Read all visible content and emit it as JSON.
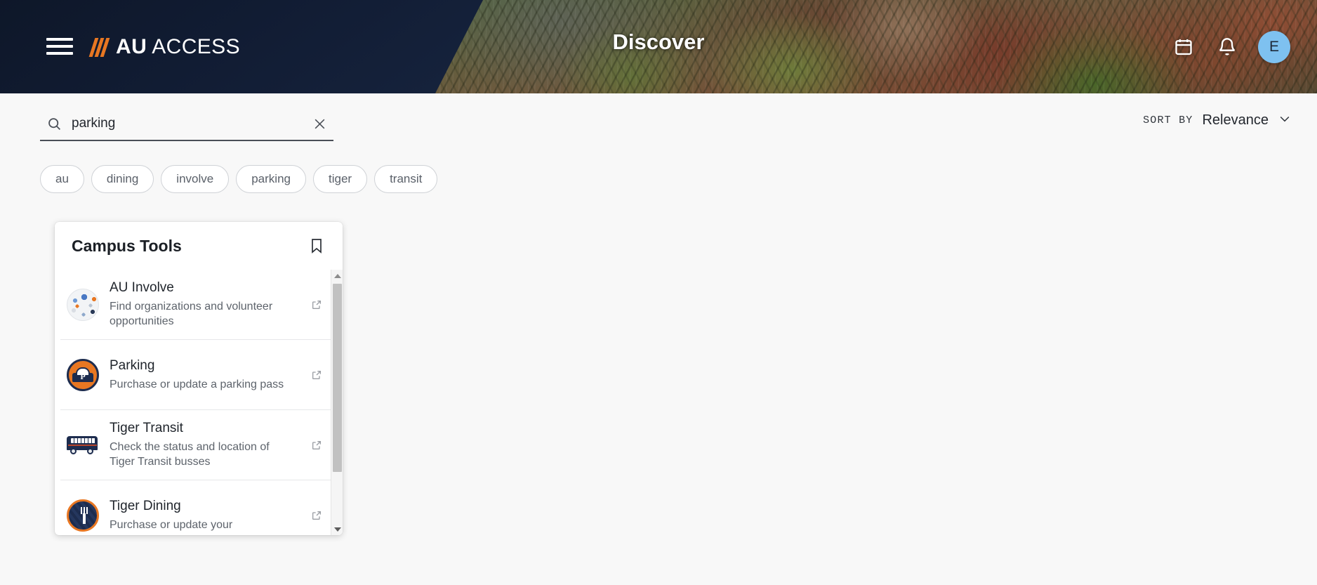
{
  "header": {
    "menu_icon": "hamburger-icon",
    "brand": {
      "bold": "AU",
      "light": "ACCESS",
      "accent_color": "#e87722"
    },
    "page_title": "Discover",
    "navy_color": "#111c33",
    "actions": [
      {
        "name": "calendar-icon",
        "label": "Calendar"
      },
      {
        "name": "bell-icon",
        "label": "Notifications"
      }
    ],
    "avatar": {
      "initial": "E",
      "color": "#7ec1f0"
    }
  },
  "search": {
    "icon": "search-icon",
    "value": "parking",
    "placeholder": "Search",
    "clear_icon": "close-icon"
  },
  "sort": {
    "label": "SORT BY",
    "value": "Relevance",
    "chevron_icon": "chevron-down-icon",
    "options": [
      "Relevance"
    ]
  },
  "chips": [
    {
      "label": "au"
    },
    {
      "label": "dining"
    },
    {
      "label": "involve"
    },
    {
      "label": "parking"
    },
    {
      "label": "tiger"
    },
    {
      "label": "transit"
    }
  ],
  "card": {
    "title": "Campus Tools",
    "bookmark_icon": "bookmark-icon",
    "items": [
      {
        "title": "AU Involve",
        "desc": "Find organizations and volunteer opportunities",
        "icon": "au-involve-icon",
        "link_icon": "external-link-icon"
      },
      {
        "title": "Parking",
        "desc": "Purchase or update a parking pass",
        "icon": "parking-icon",
        "link_icon": "external-link-icon"
      },
      {
        "title": "Tiger Transit",
        "desc": "Check the status and location of Tiger Transit busses",
        "icon": "bus-icon",
        "link_icon": "external-link-icon"
      },
      {
        "title": "Tiger Dining",
        "desc": "Purchase or update your",
        "icon": "dining-icon",
        "link_icon": "external-link-icon"
      }
    ],
    "scrollbar": {
      "up_icon": "scroll-up-arrow-icon",
      "down_icon": "scroll-down-arrow-icon"
    }
  }
}
